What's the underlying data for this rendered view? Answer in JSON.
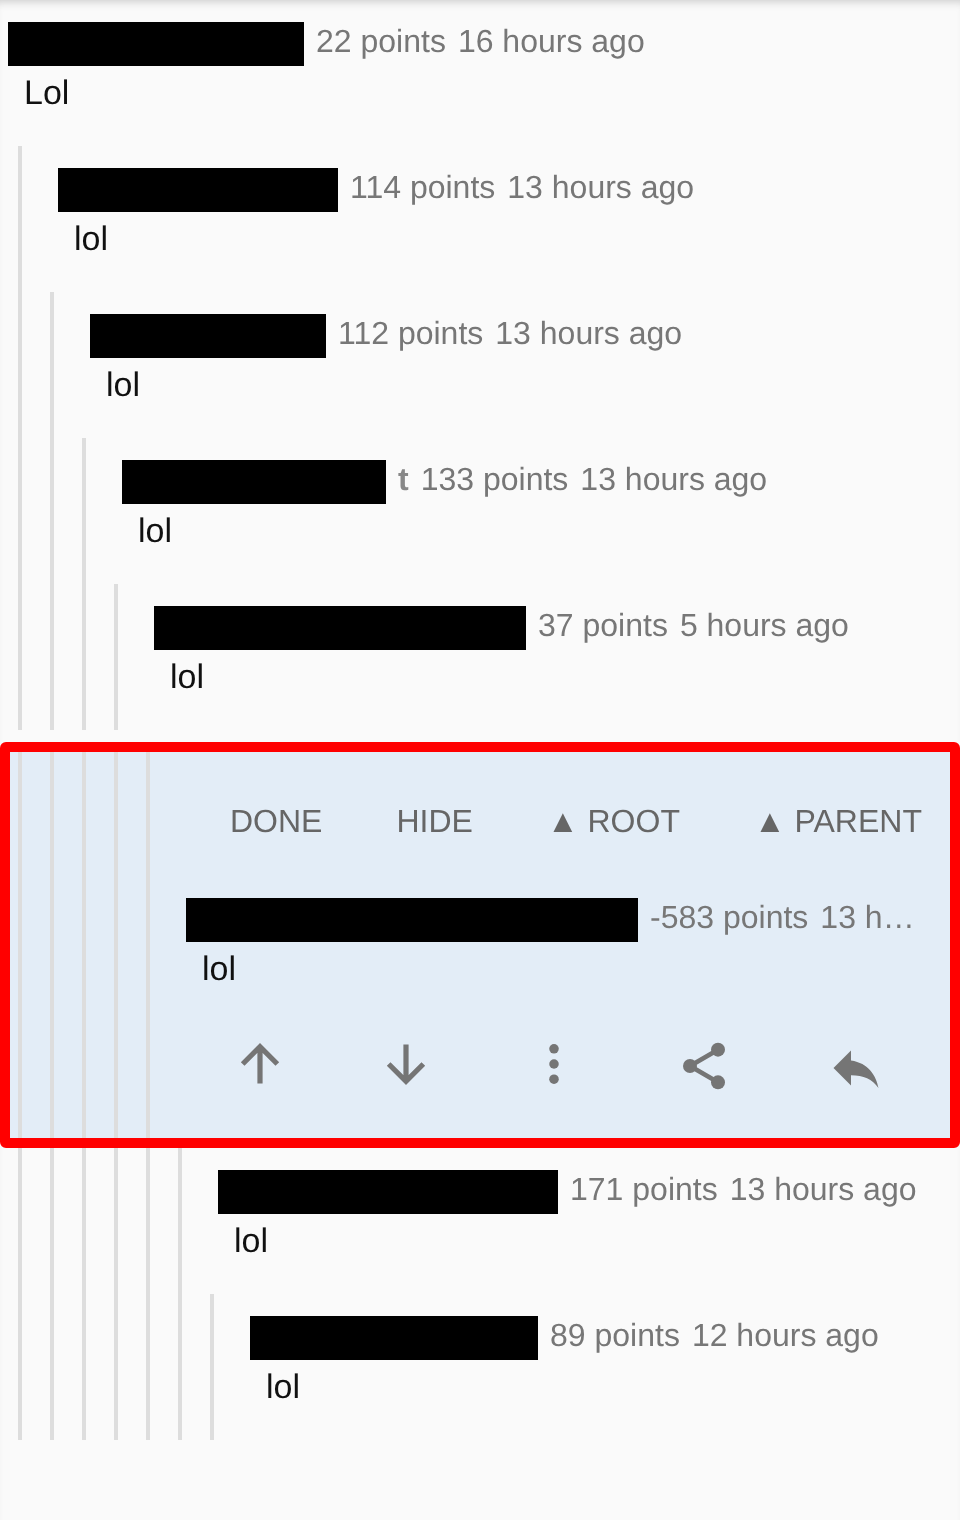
{
  "comments": [
    {
      "points": "22 points",
      "time": "16 hours ago",
      "body": "Lol",
      "selected": false,
      "children": [
        {
          "points": "114 points",
          "time": "13 hours ago",
          "body": "lol",
          "selected": false,
          "children": [
            {
              "points": "112 points",
              "time": "13 hours ago",
              "body": "lol",
              "selected": false,
              "children": [
                {
                  "author_visible_part": "t",
                  "points": "133 points",
                  "time": "13 hours ago",
                  "body": "lol",
                  "selected": false,
                  "children": [
                    {
                      "points": "37 points",
                      "time": "5 hours ago",
                      "body": "lol",
                      "selected": false,
                      "children": [
                        {
                          "points": "-583 points",
                          "time": "13 h…",
                          "body": "lol",
                          "selected": true,
                          "actions": [
                            "DONE",
                            "HIDE",
                            "▲ ROOT",
                            "▲ PARENT"
                          ],
                          "children": [
                            {
                              "points": "171 points",
                              "time": "13 hours ago",
                              "body": "lol",
                              "selected": false,
                              "children": [
                                {
                                  "points": "89 points",
                                  "time": "12 hours ago",
                                  "body": "lol",
                                  "selected": false
                                }
                              ]
                            }
                          ]
                        }
                      ]
                    }
                  ]
                }
              ]
            }
          ]
        }
      ]
    }
  ]
}
